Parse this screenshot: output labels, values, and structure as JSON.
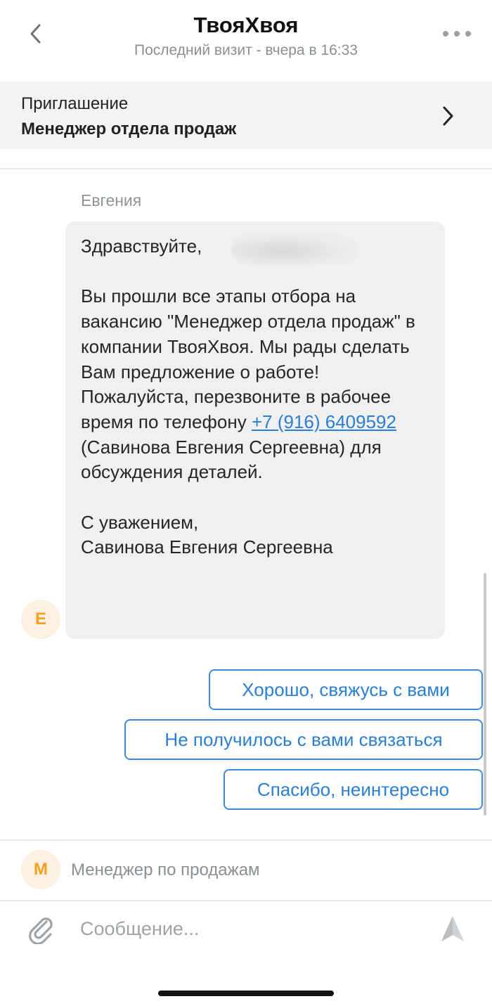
{
  "header": {
    "title": "ТвояХвоя",
    "subtitle": "Последний визит - вчера в 16:33",
    "back_icon": "chevron-left-icon",
    "more_icon": "more-horizontal-icon"
  },
  "invitation": {
    "label": "Приглашение",
    "value": "Менеджер отдела продаж",
    "chevron_icon": "chevron-right-icon"
  },
  "message": {
    "sender": "Евгения",
    "avatar_letter": "Е",
    "greeting": "Здравствуйте,",
    "body_before_link": "Вы прошли все этапы отбора на вакансию \"Менеджер отдела продаж\" в компании ТвояХвоя. Мы рады сделать Вам предложение о работе! Пожалуйста, перезвоните в рабочее время по телефону ",
    "phone_link": "+7 (916) 6409592",
    "body_after_link": " (Савинова Евгения Сергеевна) для обсуждения деталей.",
    "closing": "С уважением,",
    "signature": "Савинова Евгения Сергеевна"
  },
  "quick_replies": [
    "Хорошо, свяжусь с вами",
    "Не получилось с вами связаться",
    "Спасибо, неинтересно"
  ],
  "vacancy": {
    "avatar_letter": "М",
    "text": "Менеджер по продажам"
  },
  "composer": {
    "placeholder": "Сообщение...",
    "attach_icon": "paperclip-icon",
    "send_icon": "send-icon"
  },
  "colors": {
    "accent": "#2a7fd4",
    "avatar_bg": "#fdf0e0",
    "avatar_text": "#f0a020",
    "bubble_bg": "#f0f0f0"
  }
}
